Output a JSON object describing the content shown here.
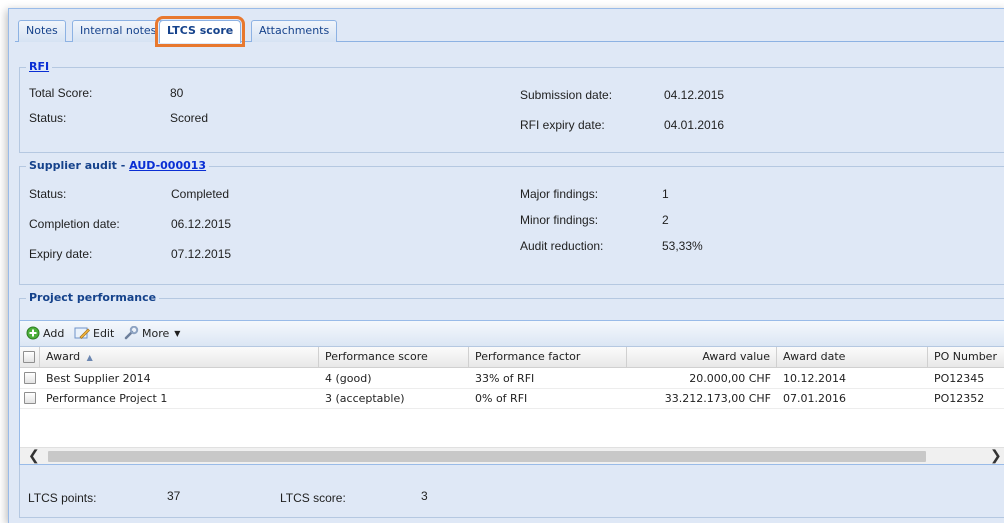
{
  "tabs": [
    {
      "label": "Notes"
    },
    {
      "label": "Internal notes"
    },
    {
      "label": "LTCS score"
    },
    {
      "label": "Attachments"
    }
  ],
  "rfi": {
    "legend": "RFI",
    "total_score_label": "Total Score:",
    "total_score": "80",
    "status_label": "Status:",
    "status": "Scored",
    "submission_label": "Submission date:",
    "submission_date": "04.12.2015",
    "expiry_label": "RFI expiry date:",
    "expiry_date": "04.01.2016"
  },
  "audit": {
    "legend_prefix": "Supplier audit - ",
    "legend_link": "AUD-000013",
    "status_label": "Status:",
    "status": "Completed",
    "completion_label": "Completion date:",
    "completion_date": "06.12.2015",
    "expiry_label": "Expiry date:",
    "expiry_date": "07.12.2015",
    "major_label": "Major findings:",
    "major": "1",
    "minor_label": "Minor findings:",
    "minor": "2",
    "reduction_label": "Audit reduction:",
    "reduction": "53,33%"
  },
  "project": {
    "legend": "Project performance",
    "toolbar": {
      "add": "Add",
      "edit": "Edit",
      "more": "More"
    },
    "columns": [
      "Award",
      "Performance score",
      "Performance factor",
      "Award value",
      "Award date",
      "PO Number"
    ],
    "rows": [
      [
        "Best Supplier 2014",
        "4 (good)",
        "33% of RFI",
        "20.000,00 CHF",
        "10.12.2014",
        "PO12345"
      ],
      [
        "Performance Project 1",
        "3 (acceptable)",
        "0% of RFI",
        "33.212.173,00 CHF",
        "07.01.2016",
        "PO12352"
      ]
    ],
    "ltcs_points_label": "LTCS points:",
    "ltcs_points": "37",
    "ltcs_score_label": "LTCS score:",
    "ltcs_score": "3"
  },
  "colors": {
    "accent": "#e8782e",
    "header_text": "#15428b",
    "link": "#0a2ed4",
    "panel_bg": "#dfe8f6"
  }
}
